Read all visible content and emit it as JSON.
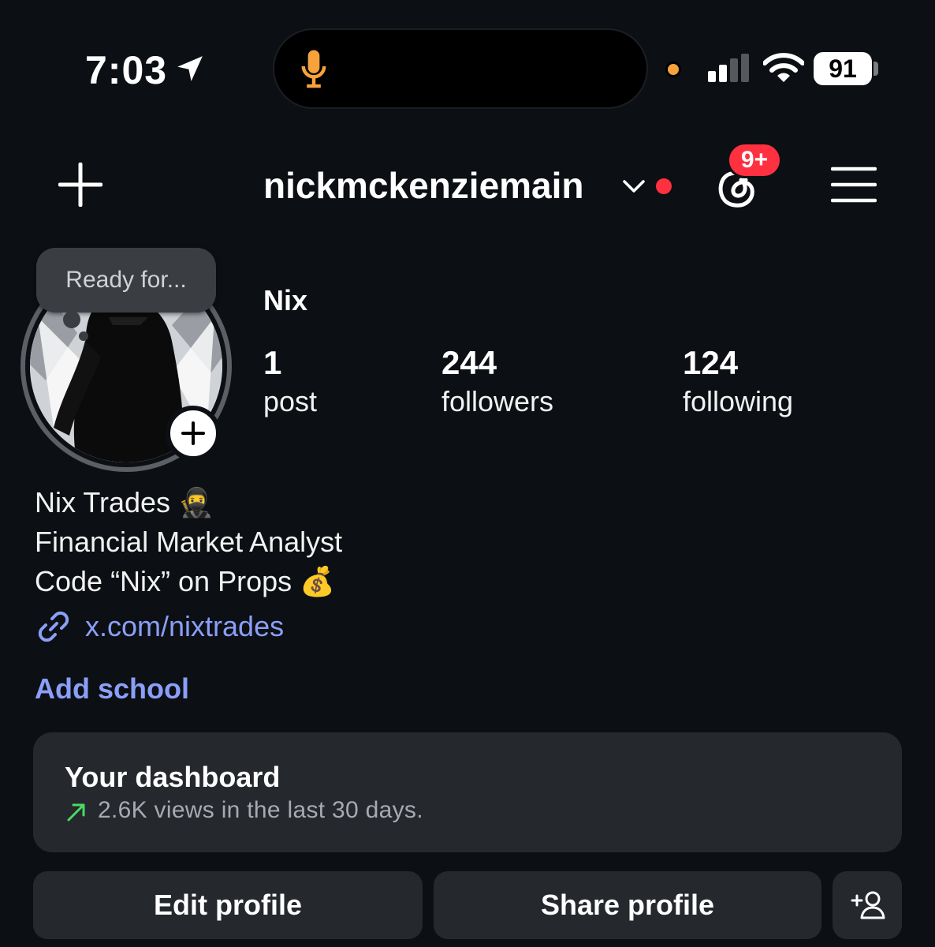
{
  "status_bar": {
    "time": "7:03",
    "battery": "91",
    "colors": {
      "mic": "#f7a23b",
      "recording_dot": "#f7a23b"
    }
  },
  "header": {
    "username": "nickmckenziemain",
    "notification_badge": "9+",
    "icons": [
      "plus-icon",
      "chevron-down-icon",
      "threads-icon",
      "menu-icon"
    ]
  },
  "profile": {
    "note": "Ready for...",
    "display_name": "Nix",
    "stats": [
      {
        "value": "1",
        "label": "post"
      },
      {
        "value": "244",
        "label": "followers"
      },
      {
        "value": "124",
        "label": "following"
      }
    ],
    "bio_lines": [
      "Nix Trades 🥷",
      "Financial Market Analyst",
      "Code “Nix” on Props 💰"
    ],
    "link": "x.com/nixtrades",
    "add_school": "Add school"
  },
  "dashboard": {
    "title": "Your dashboard",
    "subtitle": "2.6K views in the last 30 days."
  },
  "buttons": {
    "edit": "Edit profile",
    "share": "Share profile"
  },
  "colors": {
    "background": "#0c1014",
    "accent_link": "#8b9ff7",
    "badge_red": "#ff3040",
    "trend_green": "#4cd964",
    "card": "#25292e"
  }
}
